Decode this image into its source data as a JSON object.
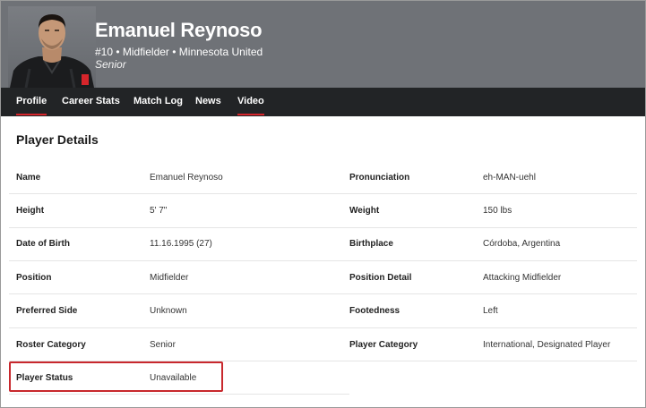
{
  "header": {
    "name": "Emanuel Reynoso",
    "meta": "#10 • Midfielder • Minnesota United",
    "class": "Senior"
  },
  "nav": {
    "tabs": [
      {
        "label": "Profile",
        "active": true
      },
      {
        "label": "Career Stats",
        "active": false
      },
      {
        "label": "Match Log",
        "active": false
      },
      {
        "label": "News",
        "active": false
      },
      {
        "label": "Video",
        "active": false
      }
    ]
  },
  "details": {
    "title": "Player Details",
    "left": [
      {
        "label": "Name",
        "value": "Emanuel Reynoso"
      },
      {
        "label": "Height",
        "value": "5' 7\""
      },
      {
        "label": "Date of Birth",
        "value": "11.16.1995 (27)"
      },
      {
        "label": "Position",
        "value": "Midfielder"
      },
      {
        "label": "Preferred Side",
        "value": "Unknown"
      },
      {
        "label": "Roster Category",
        "value": "Senior"
      },
      {
        "label": "Player Status",
        "value": "Unavailable"
      }
    ],
    "right": [
      {
        "label": "Pronunciation",
        "value": "eh-MAN-uehl"
      },
      {
        "label": "Weight",
        "value": "150 lbs"
      },
      {
        "label": "Birthplace",
        "value": "Córdoba, Argentina"
      },
      {
        "label": "Position Detail",
        "value": "Attacking Midfielder"
      },
      {
        "label": "Footedness",
        "value": "Left"
      },
      {
        "label": "Player Category",
        "value": "International, Designated Player"
      }
    ]
  },
  "colors": {
    "hero_bg": "#6f7277",
    "nav_bg": "#222426",
    "accent": "#d6252b"
  }
}
